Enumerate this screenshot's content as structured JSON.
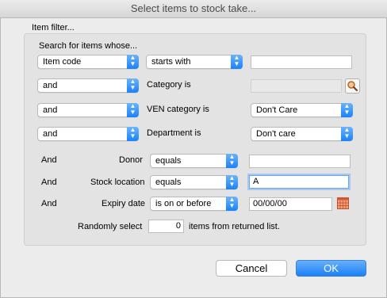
{
  "window": {
    "title": "Select items to stock take..."
  },
  "filter": {
    "group_label": "Item filter...",
    "search_label": "Search for items whose...",
    "row1": {
      "field": "Item code",
      "operator": "starts with",
      "value": ""
    },
    "row2": {
      "conj": "and",
      "label": "Category is",
      "value": ""
    },
    "row3": {
      "conj": "and",
      "label": "VEN category is",
      "value": "Don't Care"
    },
    "row4": {
      "conj": "and",
      "label": "Department is",
      "value": "Don't care"
    },
    "donor": {
      "conj": "And",
      "label": "Donor",
      "operator": "equals",
      "value": ""
    },
    "location": {
      "conj": "And",
      "label": "Stock location",
      "operator": "equals",
      "value": "A"
    },
    "expiry": {
      "conj": "And",
      "label": "Expiry date",
      "operator": "is on or before",
      "value": "00/00/00"
    },
    "random": {
      "prefix": "Randomly select",
      "count": "0",
      "suffix": "items from returned list."
    }
  },
  "buttons": {
    "cancel": "Cancel",
    "ok": "OK"
  },
  "icons": {
    "search": "magnifier-icon",
    "calendar": "calendar-icon",
    "popup": "up-down-arrows-icon"
  },
  "colors": {
    "accent": "#1a82fb"
  }
}
